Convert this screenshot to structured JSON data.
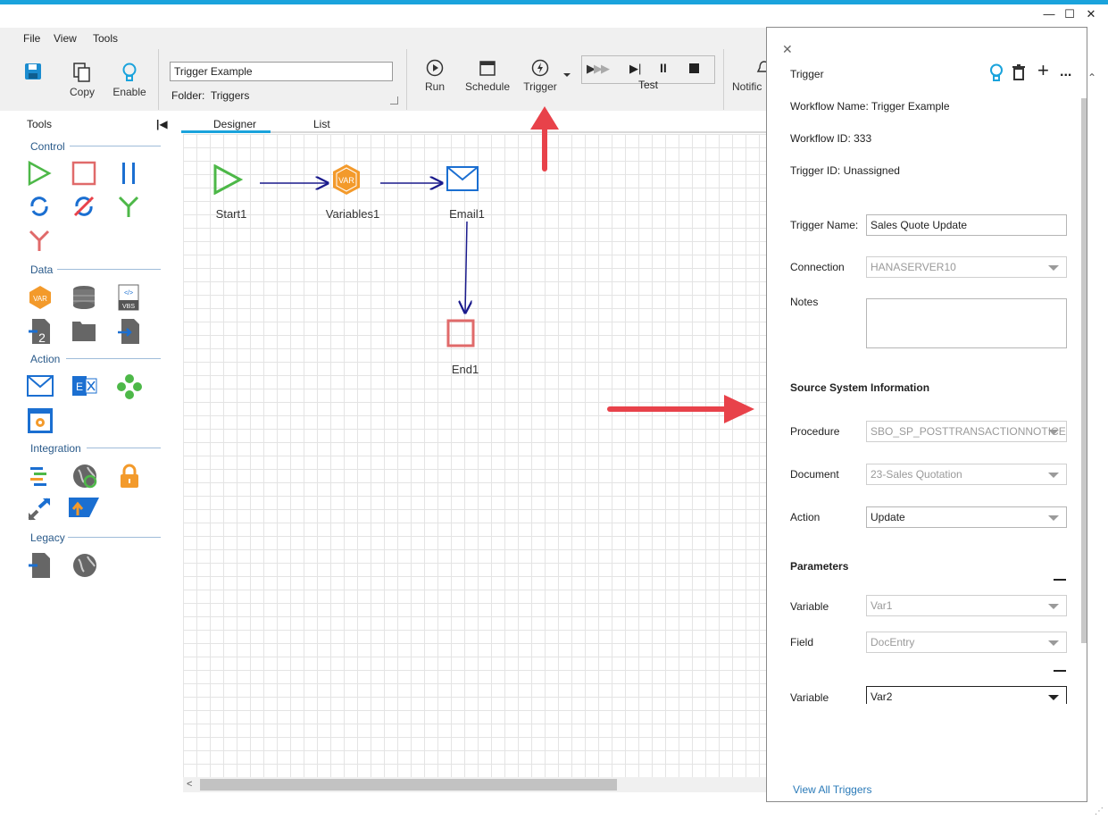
{
  "menu": [
    "File",
    "View",
    "Tools"
  ],
  "ribbon": {
    "copy_label": "Copy",
    "enable_label": "Enable",
    "workflow_name_value": "Trigger Example",
    "folder_label": "Folder:",
    "folder_value": "Triggers",
    "run_label": "Run",
    "schedule_label": "Schedule",
    "trigger_label": "Trigger",
    "test_label": "Test",
    "notifications_label": "Notific"
  },
  "tools": {
    "title": "Tools",
    "sections": [
      "Control",
      "Data",
      "Action",
      "Integration",
      "Legacy"
    ]
  },
  "tabs": [
    "Designer",
    "List"
  ],
  "canvas": {
    "nodes": [
      "Start1",
      "Variables1",
      "Email1",
      "End1"
    ],
    "var_badge": "VAR"
  },
  "panel": {
    "title": "Trigger",
    "workflow_name": "Workflow Name: Trigger Example",
    "workflow_id": "Workflow ID: 333",
    "trigger_id": "Trigger ID: Unassigned",
    "trigger_name_label": "Trigger Name:",
    "trigger_name_value": "Sales Quote Update",
    "connection_label": "Connection",
    "connection_value": "HANASERVER10",
    "notes_label": "Notes",
    "source_heading": "Source System Information",
    "procedure_label": "Procedure",
    "procedure_value": "SBO_SP_POSTTRANSACTIONNOTICE",
    "document_label": "Document",
    "document_value": "23-Sales Quotation",
    "action_label": "Action",
    "action_value": "Update",
    "parameters_heading": "Parameters",
    "variable1_label": "Variable",
    "variable1_value": "Var1",
    "field_label": "Field",
    "field_value": "DocEntry",
    "variable2_label": "Variable",
    "variable2_value": "Var2",
    "view_all_link": "View All Triggers"
  },
  "colors": {
    "accent": "#1aa3dc",
    "annotation_arrow": "#e8424a",
    "connector": "#1a1a8c",
    "start_green": "#4db848",
    "end_red": "#e06a6a",
    "var_orange": "#f39a2b",
    "email_blue": "#1b6fd1"
  }
}
